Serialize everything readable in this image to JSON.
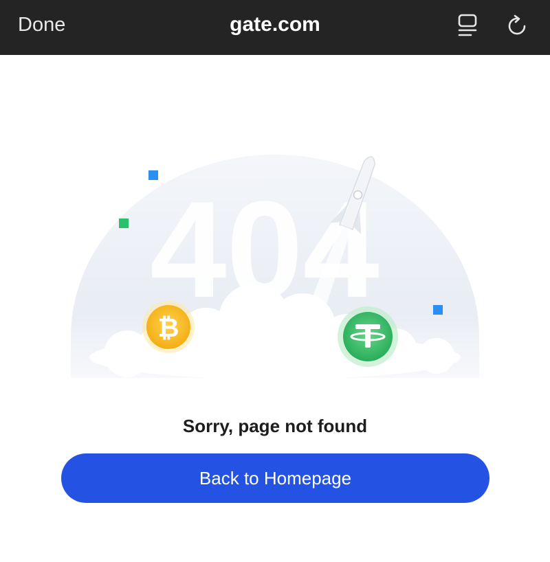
{
  "toolbar": {
    "done_label": "Done",
    "url": "gate.com",
    "reader_icon": "reader-mode-icon",
    "reload_icon": "reload-icon"
  },
  "illustration": {
    "big_text": "404",
    "badge_left_icon": "bitcoin-icon",
    "badge_right_icon": "tether-icon",
    "rocket_icon": "rocket-icon"
  },
  "content": {
    "message": "Sorry, page not found",
    "button_label": "Back to Homepage"
  },
  "colors": {
    "topbar": "#242424",
    "button": "#2453e3",
    "bitcoin": "#f5b915",
    "tether": "#3cc06a",
    "square_blue": "#2b8ef2",
    "square_green": "#27c26b"
  }
}
